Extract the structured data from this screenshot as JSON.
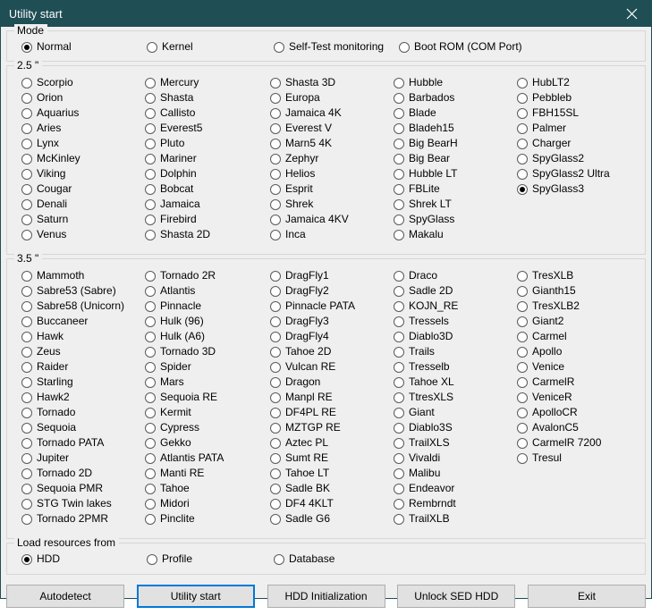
{
  "window": {
    "title": "Utility start",
    "close_icon": "close-icon",
    "titlebar_color": "#1f4e55",
    "background_color": "#efefef",
    "focus_color": "#0078d7"
  },
  "mode": {
    "legend": "Mode",
    "options": [
      {
        "label": "Normal",
        "checked": true
      },
      {
        "label": "Kernel",
        "checked": false
      },
      {
        "label": "Self-Test monitoring",
        "checked": false
      },
      {
        "label": "Boot ROM (COM Port)",
        "checked": false
      }
    ]
  },
  "group_25": {
    "legend": "2.5 \"",
    "columns": [
      [
        "Scorpio",
        "Orion",
        "Aquarius",
        "Aries",
        "Lynx",
        "McKinley",
        "Viking",
        "Cougar",
        "Denali",
        "Saturn",
        "Venus"
      ],
      [
        "Mercury",
        "Shasta",
        "Callisto",
        "Everest5",
        "Pluto",
        "Mariner",
        "Dolphin",
        "Bobcat",
        "Jamaica",
        "Firebird",
        "Shasta 2D"
      ],
      [
        "Shasta 3D",
        "Europa",
        "Jamaica 4K",
        "Everest V",
        "Marn5 4K",
        "Zephyr",
        "Helios",
        "Esprit",
        "Shrek",
        "Jamaica 4KV",
        "Inca"
      ],
      [
        "Hubble",
        "Barbados",
        "Blade",
        "Bladeh15",
        "Big BearH",
        "Big Bear",
        "Hubble LT",
        "FBLite",
        "Shrek LT",
        "SpyGlass",
        "Makalu"
      ],
      [
        "HubLT2",
        "Pebbleb",
        "FBH15SL",
        "Palmer",
        "Charger",
        "SpyGlass2",
        "SpyGlass2 Ultra",
        "SpyGlass3"
      ]
    ],
    "selected": "SpyGlass3"
  },
  "group_35": {
    "legend": "3.5 \"",
    "columns": [
      [
        "Mammoth",
        "Sabre53 (Sabre)",
        "Sabre58 (Unicorn)",
        "Buccaneer",
        "Hawk",
        "Zeus",
        "Raider",
        "Starling",
        "Hawk2",
        "Tornado",
        "Sequoia",
        "Tornado PATA",
        "Jupiter",
        "Tornado 2D",
        "Sequoia PMR",
        "STG Twin lakes",
        "Tornado 2PMR"
      ],
      [
        "Tornado 2R",
        "Atlantis",
        "Pinnacle",
        "Hulk (96)",
        "Hulk (A6)",
        "Tornado 3D",
        "Spider",
        "Mars",
        "Sequoia RE",
        "Kermit",
        "Cypress",
        "Gekko",
        "Atlantis PATA",
        "Manti RE",
        "Tahoe",
        "Midori",
        "Pinclite"
      ],
      [
        "DragFly1",
        "DragFly2",
        "Pinnacle PATA",
        "DragFly3",
        "DragFly4",
        "Tahoe 2D",
        "Vulcan RE",
        "Dragon",
        "Manpl RE",
        "DF4PL RE",
        "MZTGP RE",
        "Aztec PL",
        "Sumt RE",
        "Tahoe LT",
        "Sadle BK",
        "DF4 4KLT",
        "Sadle G6"
      ],
      [
        "Draco",
        "Sadle 2D",
        "KOJN_RE",
        "Tressels",
        "Diablo3D",
        "Trails",
        "Tresselb",
        "Tahoe XL",
        "TtresXLS",
        "Giant",
        "Diablo3S",
        "TrailXLS",
        "Vivaldi",
        "Malibu",
        "Endeavor",
        "Rembrndt",
        "TrailXLB"
      ],
      [
        "TresXLB",
        "Gianth15",
        "TresXLB2",
        "Giant2",
        "Carmel",
        "Apollo",
        "Venice",
        "CarmelR",
        "VeniceR",
        "ApolloCR",
        "AvalonC5",
        "CarmelR 7200",
        "Tresul"
      ]
    ],
    "selected": null
  },
  "load_resources": {
    "legend": "Load resources from",
    "options": [
      {
        "label": "HDD",
        "checked": true
      },
      {
        "label": "Profile",
        "checked": false
      },
      {
        "label": "Database",
        "checked": false
      }
    ]
  },
  "buttons": [
    {
      "label": "Autodetect",
      "focused": false
    },
    {
      "label": "Utility start",
      "focused": true
    },
    {
      "label": "HDD Initialization",
      "focused": false
    },
    {
      "label": "Unlock SED HDD",
      "focused": false
    },
    {
      "label": "Exit",
      "focused": false
    }
  ]
}
